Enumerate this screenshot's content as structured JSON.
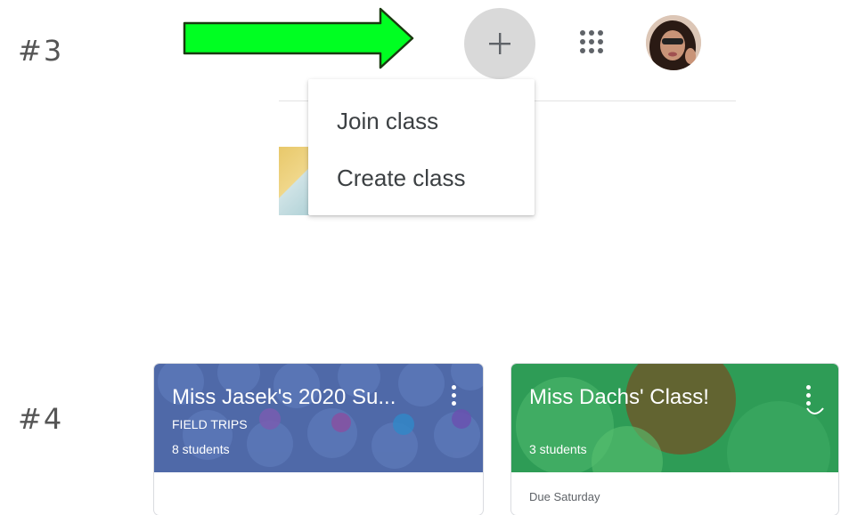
{
  "steps": {
    "step3": "#3",
    "step4": "#4"
  },
  "colors": {
    "arrow_fill": "#00ff22",
    "plus_bg": "#d9d9d9",
    "card1_bg": "#4f69a8",
    "card2_bg": "#2e9c56"
  },
  "topbar": {
    "add_icon": "plus-icon",
    "apps_icon": "apps-grid-icon"
  },
  "menu": {
    "join_label": "Join class",
    "create_label": "Create class"
  },
  "cards": [
    {
      "title": "Miss Jasek's 2020 Su...",
      "section": "FIELD TRIPS",
      "students": "8 students"
    },
    {
      "title": "Miss Dachs' Class!",
      "students": "3 students",
      "due": "Due Saturday"
    }
  ]
}
